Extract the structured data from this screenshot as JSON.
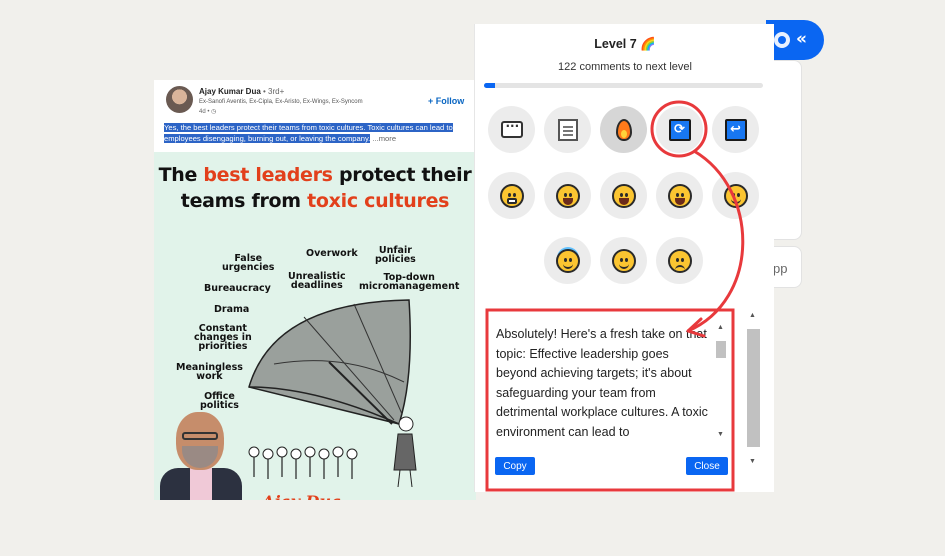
{
  "background_card": {
    "partial_label": "pp"
  },
  "post": {
    "author": "Ajay Kumar Dua",
    "degree": " • 3rd+",
    "headline": "Ex-Sanofi Aventis, Ex-Cipla, Ex-Aristo, Ex-Wings, Ex-Syncom",
    "time": "4d • ",
    "globe_icon": "globe-icon",
    "follow_label": "+ Follow",
    "caption_selected": "Yes, the best leaders protect their teams from toxic cultures. Toxic cultures can lead to employees disengaging, burning out, or leaving the company.",
    "caption_more": " ...more",
    "graphic": {
      "title_line1_a": "The ",
      "title_line1_b": "best leaders",
      "title_line1_c": " protect their",
      "title_line2_a": "teams from ",
      "title_line2_b": "toxic cultures",
      "words": [
        "False\nurgencies",
        "Overwork",
        "Unfair\npolicies",
        "Unrealistic\ndeadlines",
        "Bureaucracy",
        "Top-down\nmicromanagement",
        "Drama",
        "Constant\nchanges in\npriorities",
        "Meaningless\nwork",
        "Office\npolitics"
      ],
      "signature": "Ajay Dua",
      "colors": {
        "accent": "#e2401b",
        "background": "#e1f3ea"
      }
    }
  },
  "panel": {
    "level": "Level 7 🌈",
    "next_level": "122 comments to next level",
    "progress": 0.04,
    "tool_icons": [
      "comment-icon",
      "note-icon",
      "fire-icon",
      "refresh-icon",
      "return-icon"
    ],
    "emoji_row1": [
      "grin-emoji-icon",
      "squint-laugh-emoji-icon",
      "sweat-smile-emoji-icon",
      "tears-of-joy-emoji-icon",
      "smile-emoji-icon"
    ],
    "emoji_row2": [
      "halo-emoji-icon",
      "slight-smile-emoji-icon",
      "upside-down-emoji-icon"
    ],
    "response_text": "Absolutely! Here's a fresh take on that topic: Effective leadership goes beyond achieving targets; it's about safeguarding your team from detrimental workplace cultures. A toxic environment can lead to",
    "copy_label": "Copy",
    "close_label": "Close"
  },
  "colors": {
    "brand": "#0a66f2",
    "annotation": "#e8393c"
  }
}
